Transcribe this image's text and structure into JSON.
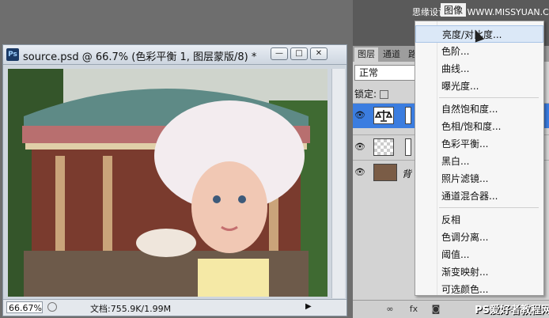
{
  "document": {
    "title": "source.psd @ 66.7% (色彩平衡 1, 图层蒙版/8) *",
    "app_badge": "Ps",
    "zoom": "66.67%",
    "doc_info": "文档:755.9K/1.99M"
  },
  "layers_panel": {
    "tabs": [
      "图层",
      "通道",
      "路"
    ],
    "blend_mode": "正常",
    "lock_label": "锁定:",
    "layers": [
      {
        "type": "adjustment",
        "name": "",
        "selected": true
      },
      {
        "type": "layer",
        "name": "",
        "selected": false
      },
      {
        "type": "background",
        "name": "背",
        "selected": false
      }
    ]
  },
  "menu": {
    "header": "图像",
    "groups": [
      [
        "亮度/对比度...",
        "色阶...",
        "曲线...",
        "曝光度..."
      ],
      [
        "自然饱和度...",
        "色相/饱和度...",
        "色彩平衡...",
        "黑白...",
        "照片滤镜...",
        "通道混合器..."
      ],
      [
        "反相",
        "色调分离...",
        "阈值...",
        "渐变映射...",
        "可选颜色..."
      ]
    ],
    "highlighted": "亮度/对比度..."
  },
  "watermarks": {
    "top_right": "思缘设计论坛 WWW.MISSYUAN.COM",
    "bottom_right": "PS爱好者教程网"
  },
  "colors": {
    "selection": "#3b7de0",
    "menu_highlight": "#dbe8f7"
  }
}
